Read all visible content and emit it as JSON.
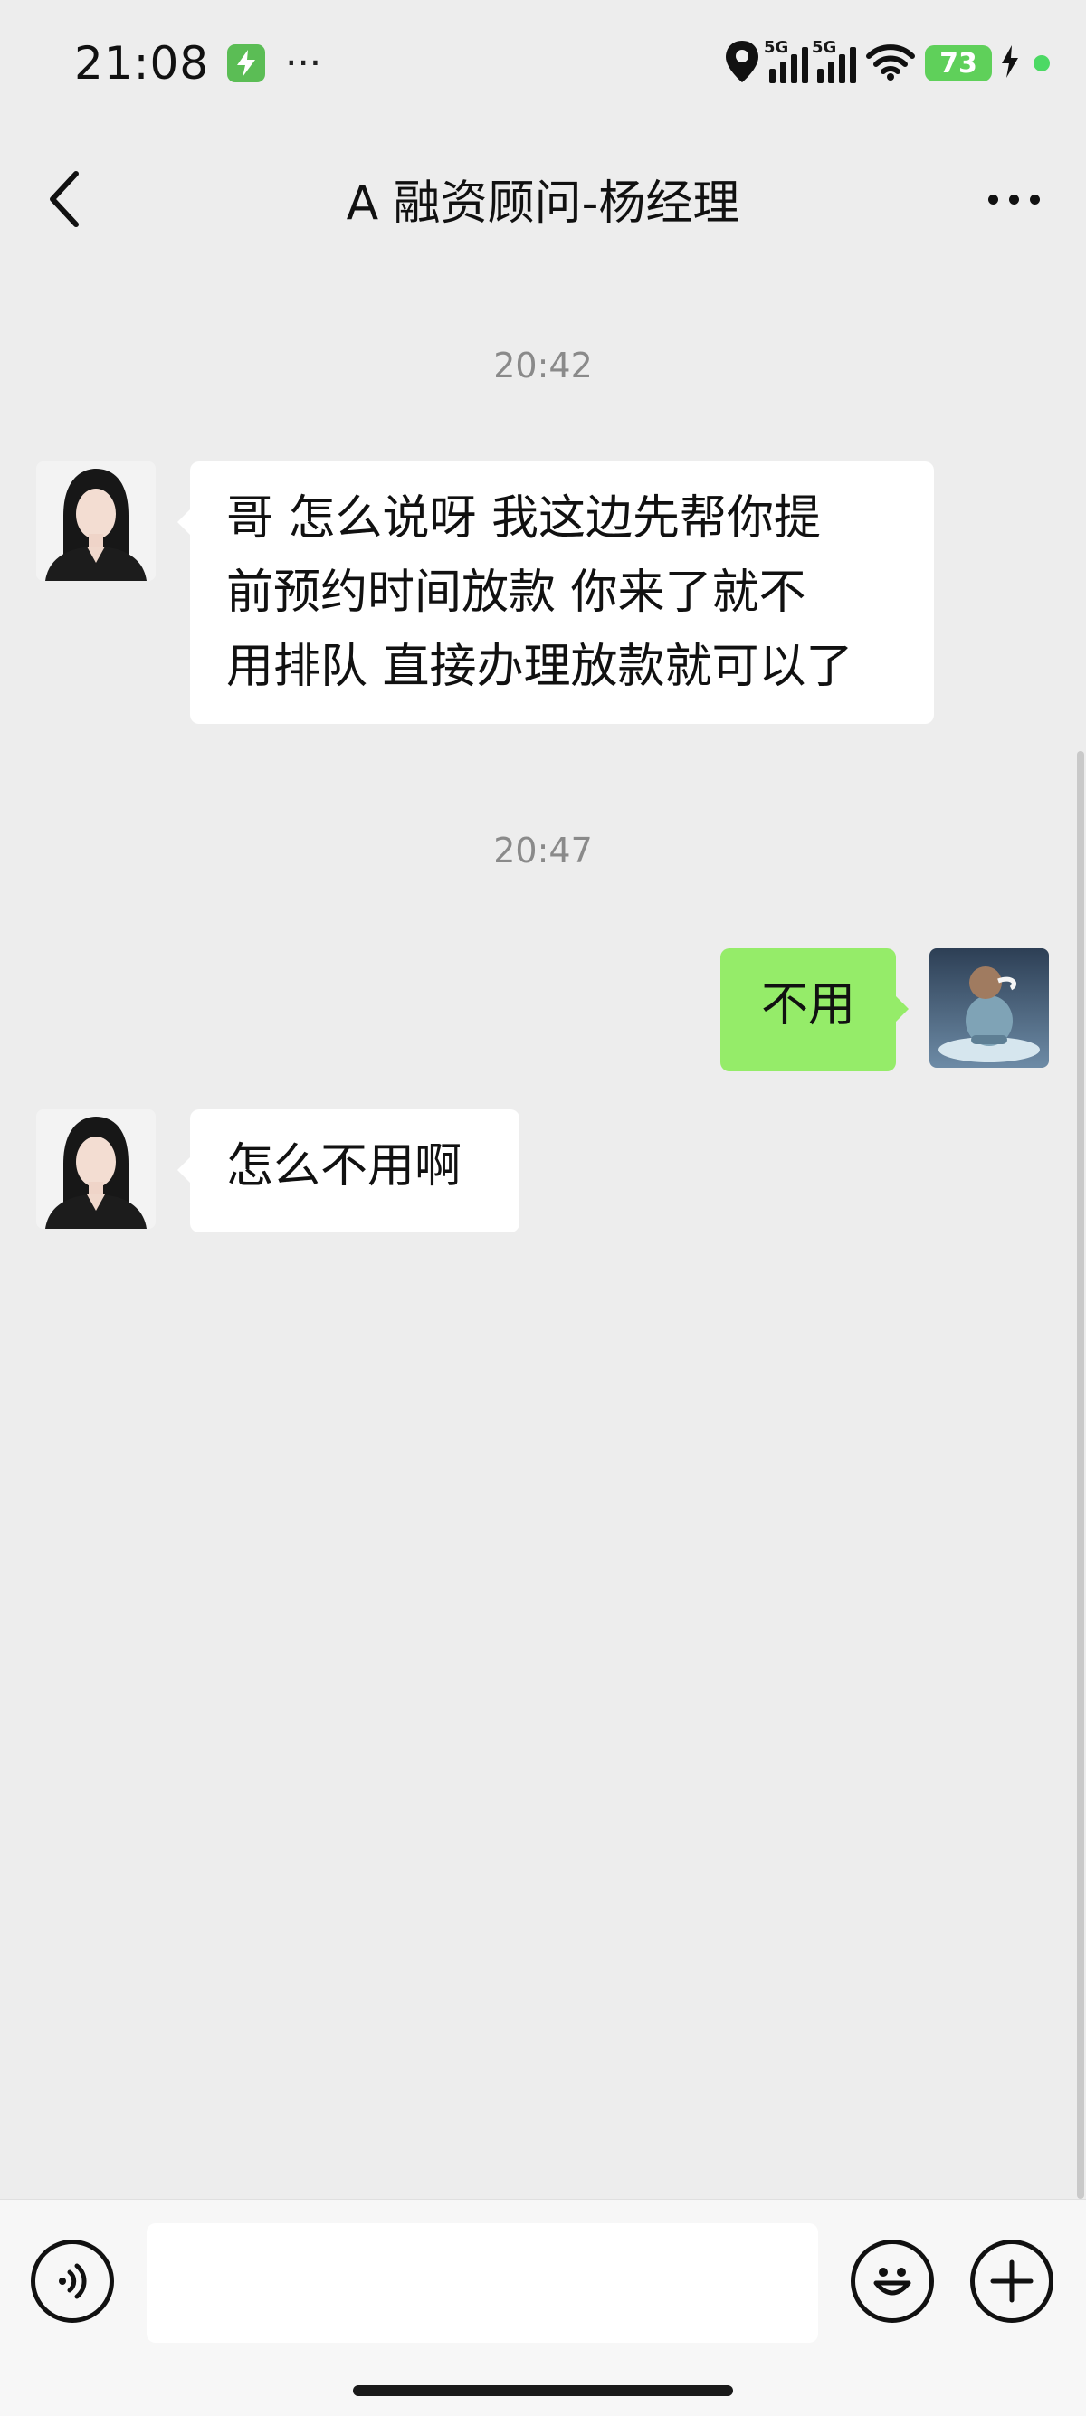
{
  "status_bar": {
    "time": "21:08",
    "more": "···",
    "network_1": "5G",
    "network_2": "5G",
    "battery": "73",
    "icons": [
      "lightning-app-icon",
      "location-icon",
      "signal-icon",
      "wifi-icon",
      "battery-icon",
      "charging-icon"
    ]
  },
  "header": {
    "title": "A 融资顾问-杨经理",
    "back_icon": "chevron-left-icon",
    "more_icon": "more-dots-icon"
  },
  "messages": [
    {
      "type": "time",
      "text": "20:42"
    },
    {
      "type": "incoming",
      "sender_avatar": "woman-portrait-avatar",
      "lines": [
        "哥  怎么说呀  我这边先帮你提",
        "前预约时间放款  你来了就不",
        "用排队 直接办理放款就可以了"
      ]
    },
    {
      "type": "time",
      "text": "20:47"
    },
    {
      "type": "outgoing",
      "sender_avatar": "cartoon-avatar",
      "text": "不用"
    },
    {
      "type": "incoming",
      "sender_avatar": "woman-portrait-avatar",
      "text": "怎么不用啊"
    }
  ],
  "input_bar": {
    "voice_icon": "voice-icon",
    "emoji_icon": "emoji-icon",
    "plus_icon": "plus-icon",
    "text_value": ""
  },
  "colors": {
    "background": "#ededed",
    "outgoing_bubble": "#95ec69",
    "incoming_bubble": "#ffffff",
    "battery": "#5fd05a"
  }
}
